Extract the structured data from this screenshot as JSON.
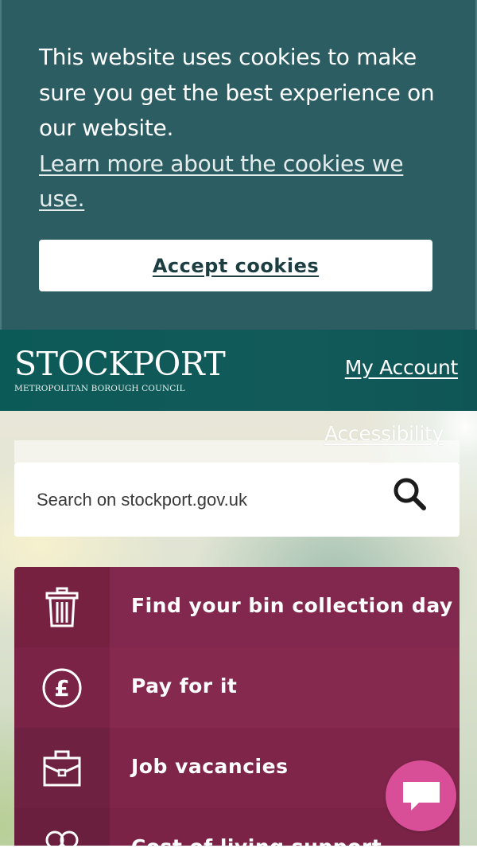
{
  "cookie_banner": {
    "message": "This website uses cookies to make sure you get the best experience on our website.",
    "learn_more_link": "Learn more about the cookies we use.",
    "accept_button": "Accept cookies"
  },
  "header": {
    "logo_main": "STOCKPORT",
    "logo_sub": "METROPOLITAN BOROUGH COUNCIL",
    "account_link": "My Account"
  },
  "accessibility_link": "Accessibility",
  "search": {
    "placeholder": "Search on stockport.gov.uk",
    "icon": "search-icon"
  },
  "quick_links": [
    {
      "label": "Find your bin collection day",
      "icon": "bin-icon"
    },
    {
      "label": "Pay for it",
      "icon": "pound-icon"
    },
    {
      "label": "Job vacancies",
      "icon": "briefcase-icon"
    },
    {
      "label": "Cost of living support",
      "icon": "hearts-icon"
    }
  ],
  "chat": {
    "icon": "chat-icon"
  },
  "colors": {
    "cookie_bg": "#2c5d62",
    "header_bg": "#0c5a58",
    "quick_link_bg": "#82284e",
    "chat_bg": "#d84f97"
  }
}
